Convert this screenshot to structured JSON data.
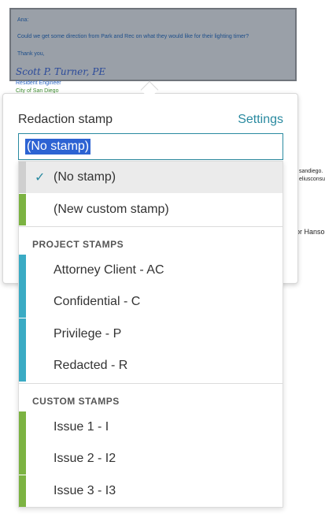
{
  "email": {
    "greeting": "Ana:",
    "body": "Could we get some direction from Park and Rec on what they would like for their lighting timer?",
    "closing": "Thank you,",
    "signature": "Scott P. Turner, PE",
    "sig_title": "Resident Engineer",
    "sig_org": "City of San Diego"
  },
  "background_fragments": {
    "right1": "sandiego.",
    "right2": "eliusconsu",
    "right3": "or Hanso"
  },
  "popover": {
    "title": "Redaction stamp",
    "settings_label": "Settings",
    "input_value": "(No stamp)"
  },
  "dropdown": {
    "top_items": [
      {
        "label": "(No stamp)",
        "selected": true,
        "bar_color": "#cfcfcf"
      },
      {
        "label": "(New custom stamp)",
        "selected": false,
        "bar_color": "#7cb342"
      }
    ],
    "project_header": "PROJECT STAMPS",
    "project_items": [
      {
        "label": "Attorney Client - AC",
        "bar_color": "#3aabc4"
      },
      {
        "label": "Confidential - C",
        "bar_color": "#3aabc4"
      },
      {
        "label": "Privilege - P",
        "bar_color": "#3aabc4"
      },
      {
        "label": "Redacted - R",
        "bar_color": "#3aabc4"
      }
    ],
    "custom_header": "CUSTOM STAMPS",
    "custom_items": [
      {
        "label": "Issue 1 - I",
        "bar_color": "#7cb342"
      },
      {
        "label": "Issue 2 - I2",
        "bar_color": "#7cb342"
      },
      {
        "label": "Issue 3 - I3",
        "bar_color": "#7cb342"
      }
    ]
  },
  "colors": {
    "accent": "#2a8aa0",
    "selection": "#2d63d3"
  }
}
